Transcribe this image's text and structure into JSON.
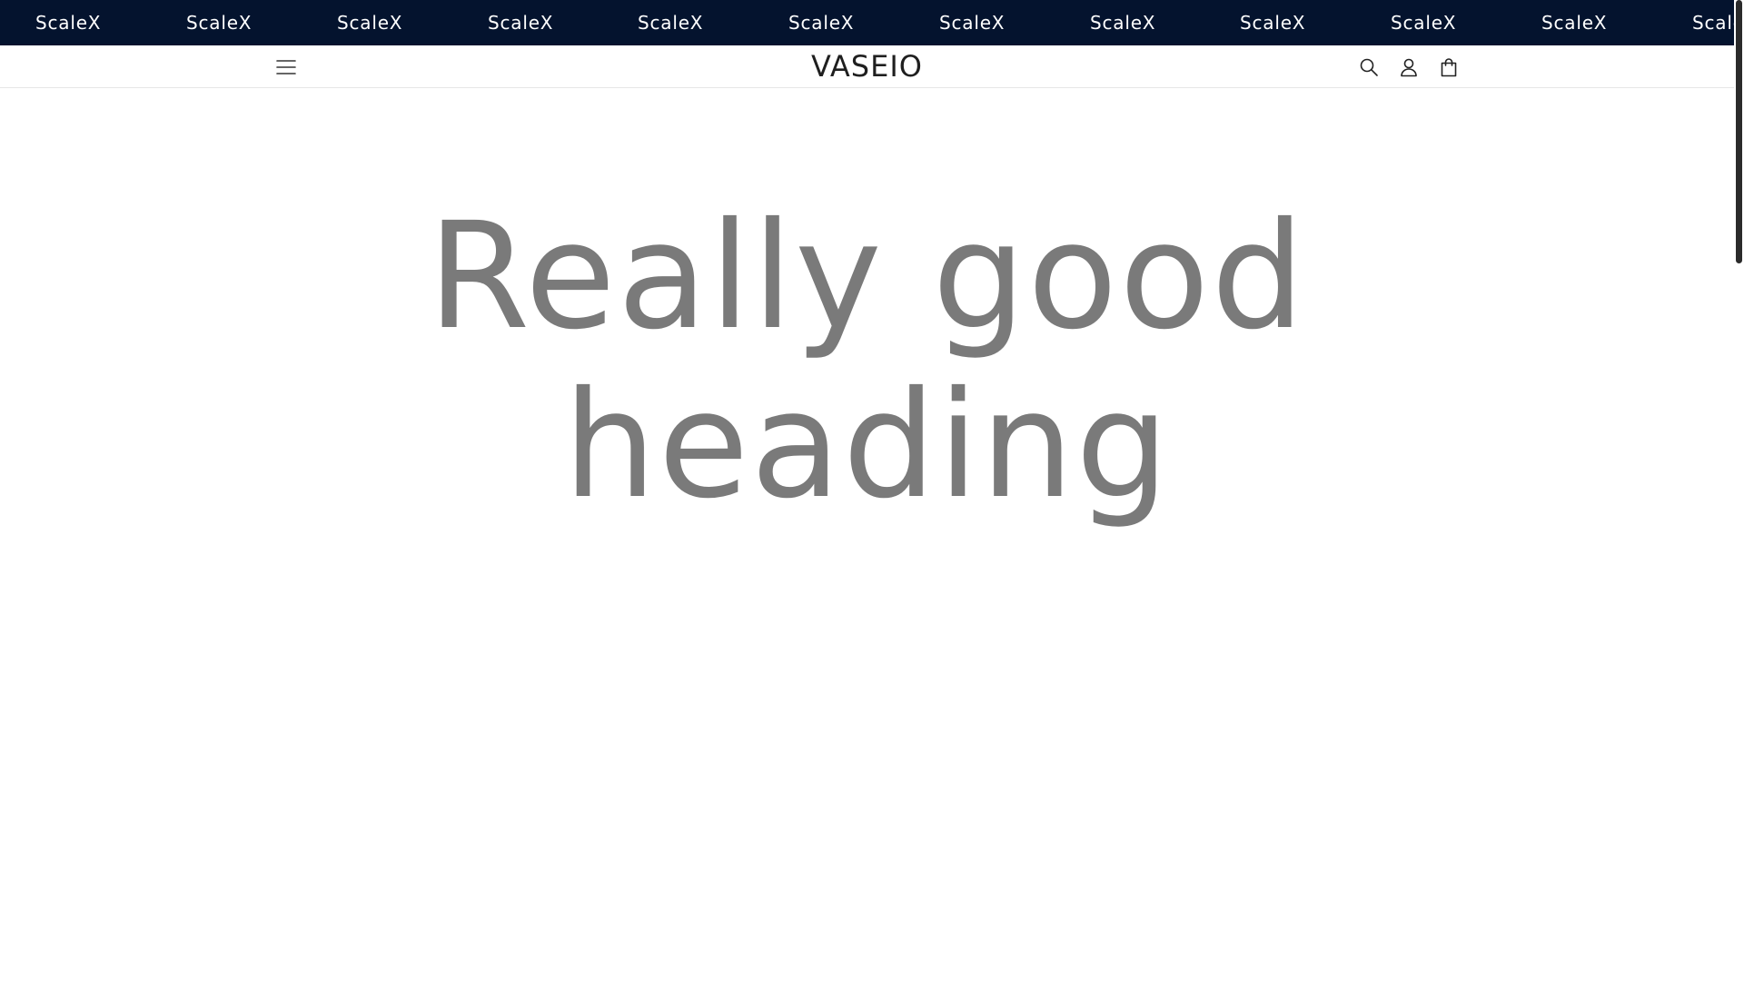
{
  "announcement": {
    "items": [
      "ScaleX",
      "ScaleX",
      "ScaleX",
      "ScaleX",
      "ScaleX",
      "ScaleX",
      "ScaleX",
      "ScaleX",
      "ScaleX",
      "ScaleX",
      "ScaleX",
      "ScaleX"
    ],
    "background": "#04132e",
    "text_color": "#ffffff"
  },
  "header": {
    "logo": "VASEIO",
    "icons": {
      "menu": "hamburger-icon",
      "search": "search-icon",
      "account": "account-icon",
      "cart": "shopping-bag-icon"
    }
  },
  "hero": {
    "heading_lines": [
      "Really good",
      "heading"
    ],
    "heading_color": "#7a7a7a"
  }
}
